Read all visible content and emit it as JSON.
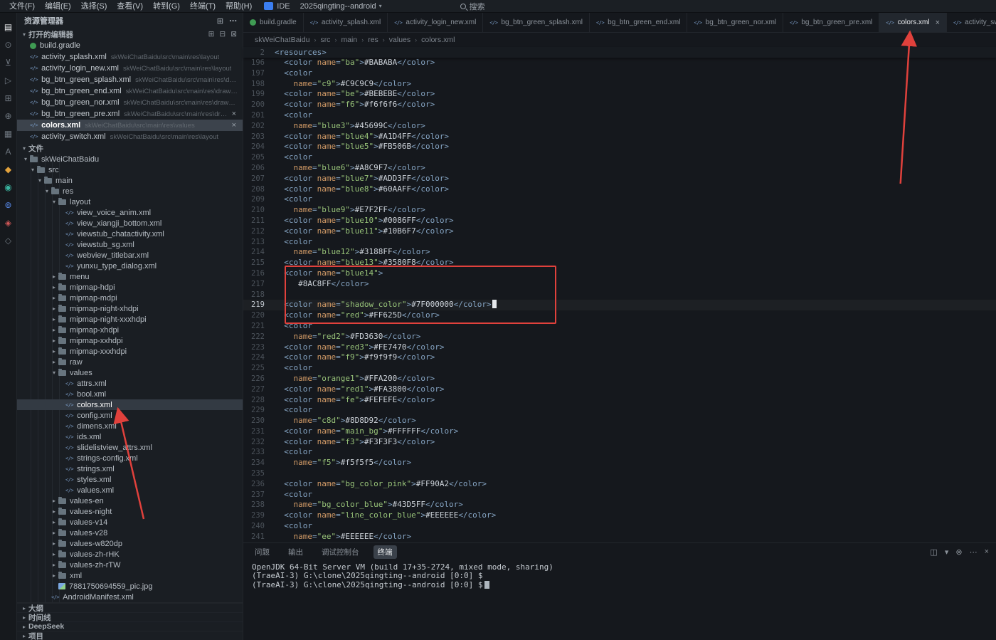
{
  "colors": {
    "annotation_red": "#e0413c",
    "accent_blue": "#3b7ef0",
    "active_tab_bg": "#22272e",
    "selection_bg": "#333a43"
  },
  "icons": {
    "chevron_down": "▾",
    "chevron_right": "▸",
    "close": "×",
    "ellipsis": "⋯"
  },
  "title_bar": {
    "menus": [
      "文件(F)",
      "编辑(E)",
      "选择(S)",
      "查看(V)",
      "转到(G)",
      "终端(T)",
      "帮助(H)"
    ],
    "ide_badge": "IDE",
    "project": "2025qingting--android",
    "search_label": "搜索"
  },
  "activity_bar": {
    "icons": [
      {
        "name": "explorer-icon",
        "glyph": "▤",
        "active": true
      },
      {
        "name": "search-icon",
        "glyph": "⊙"
      },
      {
        "name": "source-control-icon",
        "glyph": "⊻"
      },
      {
        "name": "run-debug-icon",
        "glyph": "▷"
      },
      {
        "name": "extensions-icon",
        "glyph": "⊞"
      },
      {
        "name": "testing-icon",
        "glyph": "⊕"
      },
      {
        "name": "grid-icon",
        "glyph": "▦"
      },
      {
        "name": "font-tool-icon",
        "glyph": "A"
      },
      {
        "name": "plugin-orange-icon",
        "glyph": "◆",
        "color": "#e2a23c"
      },
      {
        "name": "plugin-teal-icon",
        "glyph": "◉",
        "color": "#3ab5a0"
      },
      {
        "name": "plugin-blue-icon",
        "glyph": "⊚",
        "color": "#5b8ff5"
      },
      {
        "name": "plugin-red-icon",
        "glyph": "◈",
        "color": "#d05757"
      },
      {
        "name": "plugin-gray-icon",
        "glyph": "◇"
      }
    ]
  },
  "sidebar": {
    "title": "资源管理器",
    "header_actions": [
      {
        "name": "new-file-icon",
        "glyph": "⊞"
      },
      {
        "name": "more-actions-icon",
        "glyph": "⋯"
      }
    ],
    "open_editors": {
      "label": "打开的编辑器",
      "actions": [
        {
          "name": "new-untitled-editor-icon",
          "glyph": "⊞"
        },
        {
          "name": "save-all-icon",
          "glyph": "⊟"
        },
        {
          "name": "close-all-editors-icon",
          "glyph": "⊠"
        }
      ],
      "items": [
        {
          "file": "build.gradle",
          "icon": "gradle"
        },
        {
          "file": "activity_splash.xml",
          "icon": "xml",
          "dir": "skWeiChatBaidu\\src\\main\\res\\layout"
        },
        {
          "file": "activity_login_new.xml",
          "icon": "xml",
          "dir": "skWeiChatBaidu\\src\\main\\res\\layout"
        },
        {
          "file": "bg_btn_green_splash.xml",
          "icon": "xml",
          "dir": "skWeiChatBaidu\\src\\main\\res\\drawable"
        },
        {
          "file": "bg_btn_green_end.xml",
          "icon": "xml",
          "dir": "skWeiChatBaidu\\src\\main\\res\\drawable"
        },
        {
          "file": "bg_btn_green_nor.xml",
          "icon": "xml",
          "dir": "skWeiChatBaidu\\src\\main\\res\\drawable"
        },
        {
          "file": "bg_btn_green_pre.xml",
          "icon": "xml",
          "dir": "skWeiChatBaidu\\src\\main\\res\\drawable",
          "closable": true
        },
        {
          "file": "colors.xml",
          "icon": "xml",
          "dir": "skWeiChatBaidu\\src\\main\\res\\values",
          "active": true,
          "closable": true
        },
        {
          "file": "activity_switch.xml",
          "icon": "xml",
          "dir": "skWeiChatBaidu\\src\\main\\res\\layout"
        }
      ]
    },
    "files_section": {
      "label": "文件",
      "tree": [
        {
          "label": "skWeiChatBaidu",
          "depth": 0,
          "kind": "folder-open"
        },
        {
          "label": "src",
          "depth": 1,
          "kind": "folder-open"
        },
        {
          "label": "main",
          "depth": 2,
          "kind": "folder-open"
        },
        {
          "label": "res",
          "depth": 3,
          "kind": "folder-open"
        },
        {
          "label": "layout",
          "depth": 4,
          "kind": "folder-open"
        },
        {
          "label": "view_voice_anim.xml",
          "depth": 5,
          "kind": "xml"
        },
        {
          "label": "view_xiangji_bottom.xml",
          "depth": 5,
          "kind": "xml"
        },
        {
          "label": "viewstub_chatactivity.xml",
          "depth": 5,
          "kind": "xml"
        },
        {
          "label": "viewstub_sg.xml",
          "depth": 5,
          "kind": "xml"
        },
        {
          "label": "webview_titlebar.xml",
          "depth": 5,
          "kind": "xml"
        },
        {
          "label": "yunxu_type_dialog.xml",
          "depth": 5,
          "kind": "xml"
        },
        {
          "label": "menu",
          "depth": 4,
          "kind": "folder"
        },
        {
          "label": "mipmap-hdpi",
          "depth": 4,
          "kind": "folder"
        },
        {
          "label": "mipmap-mdpi",
          "depth": 4,
          "kind": "folder"
        },
        {
          "label": "mipmap-night-xhdpi",
          "depth": 4,
          "kind": "folder"
        },
        {
          "label": "mipmap-night-xxxhdpi",
          "depth": 4,
          "kind": "folder"
        },
        {
          "label": "mipmap-xhdpi",
          "depth": 4,
          "kind": "folder"
        },
        {
          "label": "mipmap-xxhdpi",
          "depth": 4,
          "kind": "folder"
        },
        {
          "label": "mipmap-xxxhdpi",
          "depth": 4,
          "kind": "folder"
        },
        {
          "label": "raw",
          "depth": 4,
          "kind": "folder"
        },
        {
          "label": "values",
          "depth": 4,
          "kind": "folder-open"
        },
        {
          "label": "attrs.xml",
          "depth": 5,
          "kind": "xml"
        },
        {
          "label": "bool.xml",
          "depth": 5,
          "kind": "xml"
        },
        {
          "label": "colors.xml",
          "depth": 5,
          "kind": "xml",
          "selected": true
        },
        {
          "label": "config.xml",
          "depth": 5,
          "kind": "xml"
        },
        {
          "label": "dimens.xml",
          "depth": 5,
          "kind": "xml"
        },
        {
          "label": "ids.xml",
          "depth": 5,
          "kind": "xml"
        },
        {
          "label": "slidelistview_attrs.xml",
          "depth": 5,
          "kind": "xml"
        },
        {
          "label": "strings-config.xml",
          "depth": 5,
          "kind": "xml"
        },
        {
          "label": "strings.xml",
          "depth": 5,
          "kind": "xml"
        },
        {
          "label": "styles.xml",
          "depth": 5,
          "kind": "xml"
        },
        {
          "label": "values.xml",
          "depth": 5,
          "kind": "xml"
        },
        {
          "label": "values-en",
          "depth": 4,
          "kind": "folder"
        },
        {
          "label": "values-night",
          "depth": 4,
          "kind": "folder"
        },
        {
          "label": "values-v14",
          "depth": 4,
          "kind": "folder"
        },
        {
          "label": "values-v28",
          "depth": 4,
          "kind": "folder"
        },
        {
          "label": "values-w820dp",
          "depth": 4,
          "kind": "folder"
        },
        {
          "label": "values-zh-rHK",
          "depth": 4,
          "kind": "folder"
        },
        {
          "label": "values-zh-rTW",
          "depth": 4,
          "kind": "folder"
        },
        {
          "label": "xml",
          "depth": 4,
          "kind": "folder"
        },
        {
          "label": "7881750694559_pic.jpg",
          "depth": 4,
          "kind": "img"
        },
        {
          "label": "AndroidManifest.xml",
          "depth": 3,
          "kind": "xml"
        }
      ]
    },
    "bottom_sections": [
      "大纲",
      "时间线",
      "DeepSeek",
      "项目"
    ]
  },
  "editor": {
    "tabs": [
      {
        "label": "build.gradle",
        "icon": "gradle"
      },
      {
        "label": "activity_splash.xml",
        "icon": "xml"
      },
      {
        "label": "activity_login_new.xml",
        "icon": "xml"
      },
      {
        "label": "bg_btn_green_splash.xml",
        "icon": "xml"
      },
      {
        "label": "bg_btn_green_end.xml",
        "icon": "xml"
      },
      {
        "label": "bg_btn_green_nor.xml",
        "icon": "xml"
      },
      {
        "label": "bg_btn_green_pre.xml",
        "icon": "xml"
      },
      {
        "label": "colors.xml",
        "icon": "xml",
        "active": true,
        "close": true
      },
      {
        "label": "activity_switch.xml",
        "icon": "xml"
      },
      {
        "label": "",
        "icon": "xml",
        "partial": true
      }
    ],
    "breadcrumb": {
      "items": [
        "skWeiChatBaidu",
        "src",
        "main",
        "res",
        "values",
        "colors.xml"
      ],
      "separator": "›"
    },
    "sticky": {
      "number": "2",
      "tag_text": "<resources>"
    },
    "syntax": {
      "tag": "#86a5c4",
      "attr": "#d19a66",
      "string": "#98c379",
      "text": "#ccd2d9"
    },
    "code_lines": [
      {
        "n": 196,
        "t": "full",
        "name": "ba",
        "val": "#BABABA"
      },
      {
        "n": 197,
        "t": "open"
      },
      {
        "n": 198,
        "t": "cont",
        "name": "c9",
        "val": "#C9C9C9"
      },
      {
        "n": 199,
        "t": "full",
        "name": "be",
        "val": "#BEBEBE"
      },
      {
        "n": 200,
        "t": "full",
        "name": "f6",
        "val": "#f6f6f6"
      },
      {
        "n": 201,
        "t": "open"
      },
      {
        "n": 202,
        "t": "cont",
        "name": "blue3",
        "val": "#45699C"
      },
      {
        "n": 203,
        "t": "full",
        "name": "blue4",
        "val": "#A1D4FF"
      },
      {
        "n": 204,
        "t": "full",
        "name": "blue5",
        "val": "#FB506B"
      },
      {
        "n": 205,
        "t": "open"
      },
      {
        "n": 206,
        "t": "cont",
        "name": "blue6",
        "val": "#A8C9F7"
      },
      {
        "n": 207,
        "t": "full",
        "name": "blue7",
        "val": "#ADD3FF"
      },
      {
        "n": 208,
        "t": "full",
        "name": "blue8",
        "val": "#60AAFF"
      },
      {
        "n": 209,
        "t": "open"
      },
      {
        "n": 210,
        "t": "cont",
        "name": "blue9",
        "val": "#E7F2FF"
      },
      {
        "n": 211,
        "t": "full",
        "name": "blue10",
        "val": "#0086FF"
      },
      {
        "n": 212,
        "t": "full",
        "name": "blue11",
        "val": "#10B6F7"
      },
      {
        "n": 213,
        "t": "open"
      },
      {
        "n": 214,
        "t": "cont",
        "name": "blue12",
        "val": "#3188FF"
      },
      {
        "n": 215,
        "t": "full",
        "name": "blue13",
        "val": "#3580F8"
      },
      {
        "n": 216,
        "t": "openname",
        "name": "blue14"
      },
      {
        "n": 217,
        "t": "valclose",
        "val": "#8AC8FF"
      },
      {
        "n": 218,
        "t": "blank"
      },
      {
        "n": 219,
        "t": "full",
        "name": "shadow_color",
        "val": "#7F000000",
        "cursor": true
      },
      {
        "n": 220,
        "t": "full",
        "name": "red",
        "val": "#FF625D"
      },
      {
        "n": 221,
        "t": "open"
      },
      {
        "n": 222,
        "t": "cont",
        "name": "red2",
        "val": "#FD3630"
      },
      {
        "n": 223,
        "t": "full",
        "name": "red3",
        "val": "#FE7470"
      },
      {
        "n": 224,
        "t": "full",
        "name": "f9",
        "val": "#f9f9f9"
      },
      {
        "n": 225,
        "t": "open"
      },
      {
        "n": 226,
        "t": "cont",
        "name": "orange1",
        "val": "#FFA200"
      },
      {
        "n": 227,
        "t": "full",
        "name": "red1",
        "val": "#FA3800"
      },
      {
        "n": 228,
        "t": "full",
        "name": "fe",
        "val": "#FEFEFE"
      },
      {
        "n": 229,
        "t": "open"
      },
      {
        "n": 230,
        "t": "cont",
        "name": "c8d",
        "val": "#8D8D92"
      },
      {
        "n": 231,
        "t": "full",
        "name": "main_bg",
        "val": "#FFFFFF"
      },
      {
        "n": 232,
        "t": "full",
        "name": "f3",
        "val": "#F3F3F3"
      },
      {
        "n": 233,
        "t": "open"
      },
      {
        "n": 234,
        "t": "cont",
        "name": "f5",
        "val": "#f5f5f5"
      },
      {
        "n": 235,
        "t": "blank"
      },
      {
        "n": 236,
        "t": "full",
        "name": "bg_color_pink",
        "val": "#FF90A2"
      },
      {
        "n": 237,
        "t": "open"
      },
      {
        "n": 238,
        "t": "cont",
        "name": "bg_color_blue",
        "val": "#43D5FF"
      },
      {
        "n": 239,
        "t": "full",
        "name": "line_color_blue",
        "val": "#EEEEEE"
      },
      {
        "n": 240,
        "t": "open"
      },
      {
        "n": 241,
        "t": "cont",
        "name": "ee",
        "val": "#EEEEEE"
      }
    ]
  },
  "panel": {
    "tabs": [
      {
        "label": "问题"
      },
      {
        "label": "输出"
      },
      {
        "label": "调试控制台"
      },
      {
        "label": "终端",
        "active": true
      }
    ],
    "actions": [
      {
        "name": "split-terminal-icon",
        "glyph": "◫"
      },
      {
        "name": "maximize-panel-icon",
        "glyph": "▾"
      },
      {
        "name": "trash-icon",
        "glyph": "⊗"
      },
      {
        "name": "more-panel-actions-icon",
        "glyph": "⋯"
      },
      {
        "name": "close-panel-icon",
        "glyph": "×"
      }
    ],
    "terminal_lines": [
      {
        "text": "OpenJDK 64-Bit Server VM (build 17+35-2724, mixed mode, sharing)"
      },
      {
        "text": "(TraeAI-3) G:\\clone\\2025qingting--android [0:0] $"
      },
      {
        "text": "(TraeAI-3) G:\\clone\\2025qingting--android [0:0] $",
        "cursor": true
      }
    ]
  }
}
